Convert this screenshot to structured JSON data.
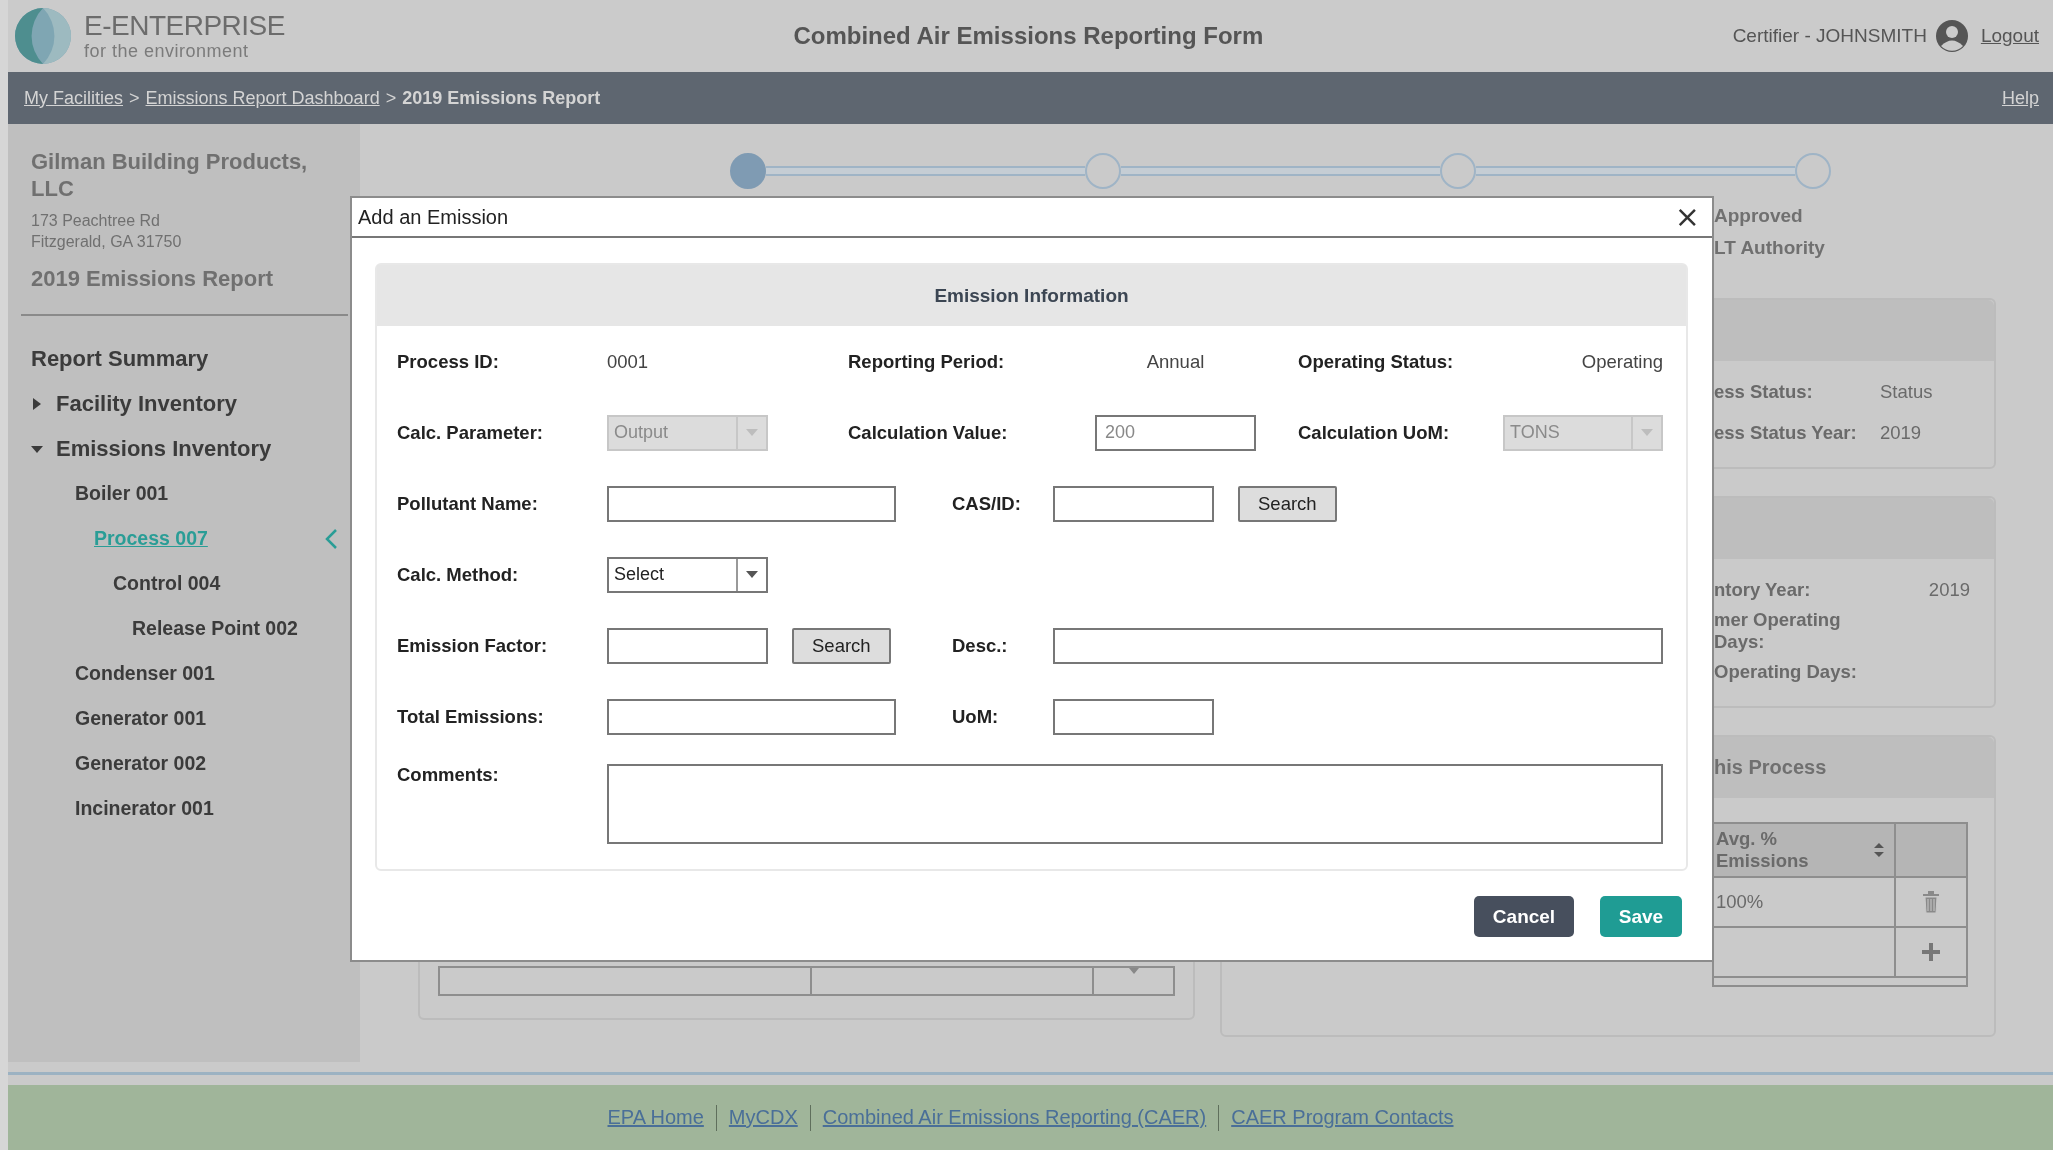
{
  "header": {
    "logo_title": "E-ENTERPRISE",
    "logo_subtitle": "for the environment",
    "title": "Combined Air Emissions Reporting Form",
    "user": "Certifier - JOHNSMITH",
    "logout": "Logout"
  },
  "breadcrumb": {
    "items": [
      {
        "kind": "link",
        "label": "My Facilities"
      },
      {
        "kind": "separator",
        "label": ">"
      },
      {
        "kind": "link",
        "label": "Emissions Report Dashboard"
      },
      {
        "kind": "separator",
        "label": ">"
      },
      {
        "kind": "current",
        "label": "2019 Emissions Report"
      }
    ],
    "help": "Help"
  },
  "sidebar": {
    "facility_name": "Gilman Building Products, LLC",
    "address": [
      "173 Peachtree Rd",
      "Fitzgerald, GA 31750"
    ],
    "report_title": "2019 Emissions Report",
    "nav": [
      {
        "label": "Report Summary",
        "selected": false
      },
      {
        "label": "Facility Inventory",
        "selected": false,
        "expanded": false
      },
      {
        "label": "Emissions Inventory",
        "selected": false,
        "expanded": true,
        "children": [
          {
            "label": "Boiler 001",
            "selected": false,
            "children": [
              {
                "label": "Process 007",
                "selected": true,
                "children": [
                  {
                    "label": "Control 004",
                    "selected": false,
                    "children": [
                      {
                        "label": "Release Point 002",
                        "selected": false
                      }
                    ]
                  }
                ]
              }
            ]
          },
          {
            "label": "Condenser 001",
            "selected": false
          },
          {
            "label": "Generator 001",
            "selected": false
          },
          {
            "label": "Generator 002",
            "selected": false
          },
          {
            "label": "Incinerator 001",
            "selected": false
          }
        ]
      }
    ]
  },
  "stepper": {
    "steps": [
      {
        "completed": true
      },
      {
        "completed": false
      },
      {
        "completed": false
      },
      {
        "completed": false
      }
    ],
    "label_lines": [
      "Approved",
      "LT Authority"
    ]
  },
  "status_panel": {
    "rows": [
      {
        "label": "ess Status:",
        "value": "Status"
      },
      {
        "label": "ess Status Year:",
        "value": "2019"
      }
    ]
  },
  "inventory_panel": {
    "rows": [
      {
        "label": "ntory Year:",
        "value": "2019"
      },
      {
        "label": "mer Operating Days:"
      },
      {
        "label": "Operating Days:"
      }
    ]
  },
  "process_panel": {
    "title": "his Process",
    "column": "Avg. % Emissions",
    "rows": [
      {
        "kind": "data",
        "value": "100%"
      },
      {
        "kind": "add"
      }
    ]
  },
  "dialog": {
    "title": "Add an Emission",
    "close": "×",
    "section_title": "Emission Information",
    "rows": [
      {
        "kind": "triple",
        "cells": [
          [
            {
              "kind": "label",
              "text": "Process ID:"
            }
          ],
          [
            {
              "kind": "value",
              "text": "0001"
            }
          ],
          [
            {
              "kind": "label",
              "text": "Reporting Period:"
            }
          ],
          [
            {
              "kind": "value",
              "text": "Annual"
            }
          ],
          [
            {
              "kind": "label",
              "text": "Operating Status:"
            }
          ],
          [
            {
              "kind": "value",
              "text": "Operating"
            }
          ]
        ]
      },
      {
        "kind": "triple",
        "cells": [
          [
            {
              "kind": "label",
              "text": "Calc. Parameter:"
            }
          ],
          [
            {
              "kind": "select",
              "value": "Output",
              "disabled": true
            }
          ],
          [
            {
              "kind": "label",
              "text": "Calculation Value:"
            }
          ],
          [
            {
              "kind": "input-short",
              "placeholder": "200"
            }
          ],
          [
            {
              "kind": "label",
              "text": "Calculation UoM:"
            }
          ],
          [
            {
              "kind": "select",
              "value": "TONS",
              "disabled": true
            }
          ]
        ]
      },
      {
        "kind": "pair",
        "cells": [
          [
            {
              "kind": "label",
              "text": "Pollutant Name:"
            }
          ],
          [
            {
              "kind": "input-long"
            }
          ],
          [
            {
              "kind": "label",
              "text": "CAS/ID:"
            }
          ],
          [
            {
              "kind": "input-short"
            },
            {
              "kind": "button",
              "label": "Search"
            }
          ]
        ]
      },
      {
        "kind": "pair",
        "cells": [
          [
            {
              "kind": "label",
              "text": "Calc. Method:"
            }
          ],
          [
            {
              "kind": "select",
              "value": "Select",
              "disabled": false
            }
          ]
        ]
      },
      {
        "kind": "pair",
        "cells": [
          [
            {
              "kind": "label",
              "text": "Emission Factor:"
            }
          ],
          [
            {
              "kind": "input-short"
            },
            {
              "kind": "button",
              "label": "Search"
            }
          ],
          [
            {
              "kind": "label",
              "text": "Desc.:"
            }
          ],
          [
            {
              "kind": "input-wide"
            }
          ]
        ]
      },
      {
        "kind": "pair",
        "cells": [
          [
            {
              "kind": "label",
              "text": "Total Emissions:"
            }
          ],
          [
            {
              "kind": "input-long"
            }
          ],
          [
            {
              "kind": "label",
              "text": "UoM:"
            }
          ],
          [
            {
              "kind": "input-short"
            }
          ]
        ]
      },
      {
        "kind": "comments",
        "cells": [
          [
            {
              "kind": "label",
              "text": "Comments:"
            }
          ],
          [
            {
              "kind": "textarea"
            }
          ]
        ]
      }
    ],
    "buttons": [
      {
        "kind": "secondary",
        "label": "Cancel"
      },
      {
        "kind": "primary",
        "label": "Save"
      }
    ]
  },
  "footer": {
    "links": [
      "EPA Home",
      "MyCDX",
      "Combined Air Emissions Reporting (CAER)",
      "CAER Program Contacts"
    ]
  }
}
